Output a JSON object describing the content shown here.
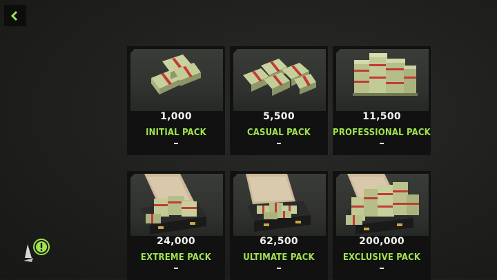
{
  "nav": {
    "back_icon": "chevron-left-icon"
  },
  "accent_color": "#9fe34f",
  "packs": [
    {
      "amount": "1,000",
      "name": "INITIAL PACK",
      "icon": "cash-stacks-small-icon",
      "status": "-"
    },
    {
      "amount": "5,500",
      "name": "CASUAL PACK",
      "icon": "cash-stacks-medium-icon",
      "status": "-"
    },
    {
      "amount": "11,500",
      "name": "PROFESSIONAL PACK",
      "icon": "cash-pile-icon",
      "status": "-"
    },
    {
      "amount": "24,000",
      "name": "EXTREME PACK",
      "icon": "cash-briefcase-icon",
      "status": "-"
    },
    {
      "amount": "62,500",
      "name": "ULTIMATE PACK",
      "icon": "cash-briefcase-icon",
      "status": "-"
    },
    {
      "amount": "200,000",
      "name": "EXCLUSIVE PACK",
      "icon": "cash-briefcase-full-icon",
      "status": "-"
    }
  ],
  "hint_icon": "alert-icon"
}
